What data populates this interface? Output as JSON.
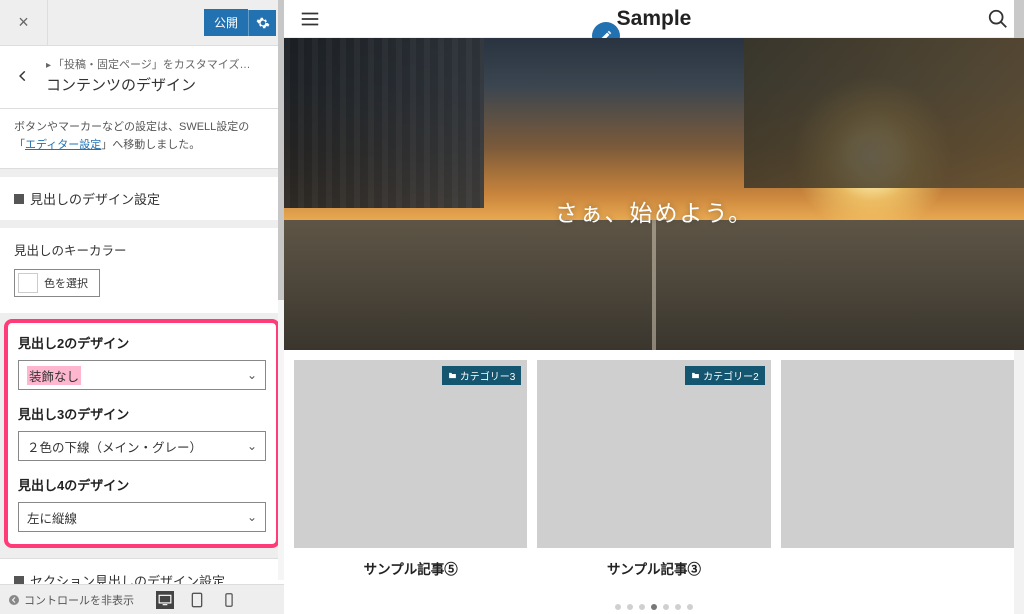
{
  "topbar": {
    "publish_label": "公開",
    "close_glyph": "×"
  },
  "crumb": {
    "parent": "「投稿・固定ページ」をカスタマイズ…",
    "title": "コンテンツのデザイン"
  },
  "note": {
    "prefix": "ボタンやマーカーなどの設定は、SWELL設定の「",
    "link": "エディター設定",
    "suffix": "」へ移動しました。"
  },
  "group1": {
    "title": "見出しのデザイン設定"
  },
  "keycolor": {
    "label": "見出しのキーカラー",
    "button": "色を選択"
  },
  "h2": {
    "label": "見出し2のデザイン",
    "value": "装飾なし"
  },
  "h3": {
    "label": "見出し3のデザイン",
    "value": "２色の下線（メイン・グレー）"
  },
  "h4": {
    "label": "見出し4のデザイン",
    "value": "左に縦線"
  },
  "group2": {
    "title": "セクション見出しのデザイン設定"
  },
  "footer": {
    "hide_controls": "コントロールを非表示"
  },
  "preview": {
    "site_title": "Sample",
    "hero_text": "さぁ、始めよう。",
    "badges": {
      "cat3": "カテゴリー3",
      "cat2": "カテゴリー2"
    },
    "cards": {
      "c1": "サンプル記事⑤",
      "c2": "サンプル記事③"
    }
  }
}
